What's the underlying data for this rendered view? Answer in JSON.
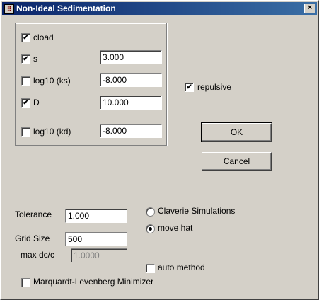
{
  "window": {
    "title": "Non-Ideal Sedimentation",
    "close_label": "×"
  },
  "group": {
    "cload": {
      "label": "cload",
      "checked": true
    },
    "s": {
      "label": "s",
      "checked": true,
      "value": "3.000"
    },
    "log_ks": {
      "label": "log10 (ks)",
      "checked": false,
      "value": "-8.000"
    },
    "D": {
      "label": "D",
      "checked": true,
      "value": "10.000"
    },
    "log_kd": {
      "label": "log10 (kd)",
      "checked": false,
      "value": "-8.000"
    }
  },
  "repulsive": {
    "label": "repulsive",
    "checked": true
  },
  "buttons": {
    "ok": "OK",
    "cancel": "Cancel"
  },
  "tolerance": {
    "label": "Tolerance",
    "value": "1.000"
  },
  "grid_size": {
    "label": "Grid Size",
    "value": "500"
  },
  "max_dc": {
    "label": "max dc/c",
    "value": "1.0000"
  },
  "mode": {
    "claverie": {
      "label": "Claverie Simulations",
      "selected": false
    },
    "move_hat": {
      "label": "move hat",
      "selected": true
    }
  },
  "auto_method": {
    "label": "auto method",
    "checked": false
  },
  "marquardt": {
    "label": "Marquardt-Levenberg Minimizer",
    "checked": false
  },
  "check_glyph": "✔"
}
